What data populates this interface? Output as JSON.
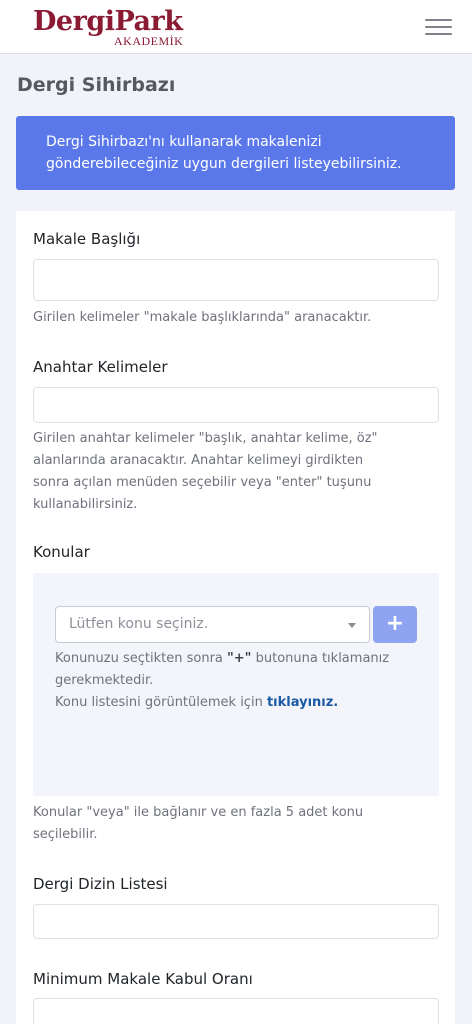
{
  "brand": {
    "name": "DergiPark",
    "sub": "AKADEMİK"
  },
  "page": {
    "title": "Dergi Sihirbazı"
  },
  "info": {
    "line1": "Dergi Sihirbazı'nı kullanarak makalenizi",
    "line2": "gönderebileceğiniz uygun dergileri listeyebilirsiniz."
  },
  "form": {
    "title_label": "Makale Başlığı",
    "title_value": "",
    "title_hint": "Girilen kelimeler \"makale başlıklarında\" aranacaktır.",
    "keywords_label": "Anahtar Kelimeler",
    "keywords_value": "",
    "keywords_hint": [
      "Girilen anahtar kelimeler \"başlık, anahtar kelime, öz\"",
      "alanlarında aranacaktır. Anahtar kelimeyi girdikten",
      "sonra açılan menüden seçebilir veya \"enter\" tuşunu",
      "kullanabilirsiniz."
    ],
    "topics_label": "Konular",
    "topics_placeholder": "Lütfen konu seçiniz.",
    "topics_add": "+",
    "topics_help_pre": "Konunuzu seçtikten sonra ",
    "topics_help_strong": "\"+\"",
    "topics_help_post": " butonuna tıklamanız",
    "topics_help_line2": "gerekmektedir.",
    "topics_list_pre": "Konu listesini görüntülemek için ",
    "topics_list_link": "tıklayınız.",
    "topics_hint": [
      "Konular \"veya\" ile bağlanır ve en fazla 5 adet konu",
      "seçilebilir."
    ],
    "index_label": "Dergi Dizin Listesi",
    "index_value": "",
    "acceptance_label": "Minimum Makale Kabul Oranı",
    "acceptance_value": ""
  }
}
